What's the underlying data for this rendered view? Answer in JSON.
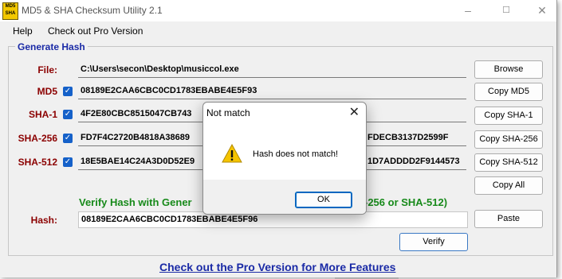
{
  "app": {
    "title": "MD5 & SHA Checksum Utility 2.1",
    "icon_text_top": "MD5",
    "icon_text_bottom": "SHA"
  },
  "menu": [
    "Help",
    "Check out Pro Version"
  ],
  "generate": {
    "group_title": "Generate Hash",
    "file_label": "File:",
    "file_path": "C:\\Users\\secon\\Desktop\\musiccol.exe",
    "browse_label": "Browse",
    "rows": [
      {
        "label": "MD5",
        "value": "08189E2CAA6CBC0CD1783EBABE4E5F93",
        "button": "Copy MD5",
        "checked": true
      },
      {
        "label": "SHA-1",
        "value": "4F2E80CBC8515047CB743",
        "button": "Copy SHA-1",
        "checked": true
      },
      {
        "label": "SHA-256",
        "value": "FD7F4C2720B4818A38689",
        "value_tail": "FDECB3137D2599F",
        "button": "Copy SHA-256",
        "checked": true
      },
      {
        "label": "SHA-512",
        "value": "18E5BAE14C24A3D0D52E9",
        "value_tail": "1D7ADDDD2F9144573",
        "button": "Copy SHA-512",
        "checked": true
      }
    ],
    "copy_all_label": "Copy All"
  },
  "verify": {
    "title_left": "Verify Hash with Gener",
    "title_right": "-256 or SHA-512)",
    "hash_label": "Hash:",
    "hash_value": "08189E2CAA6CBC0CD1783EBABE4E5F96",
    "paste_label": "Paste",
    "verify_label": "Verify"
  },
  "footer_link": "Check out the Pro Version for More Features",
  "dialog": {
    "title": "Not match",
    "message": "Hash does not match!",
    "ok_label": "OK"
  },
  "colors": {
    "label_red": "#8b0000",
    "group_blue": "#1a2aa6",
    "verify_green": "#178a1a",
    "checkbox_blue": "#1561c9"
  }
}
